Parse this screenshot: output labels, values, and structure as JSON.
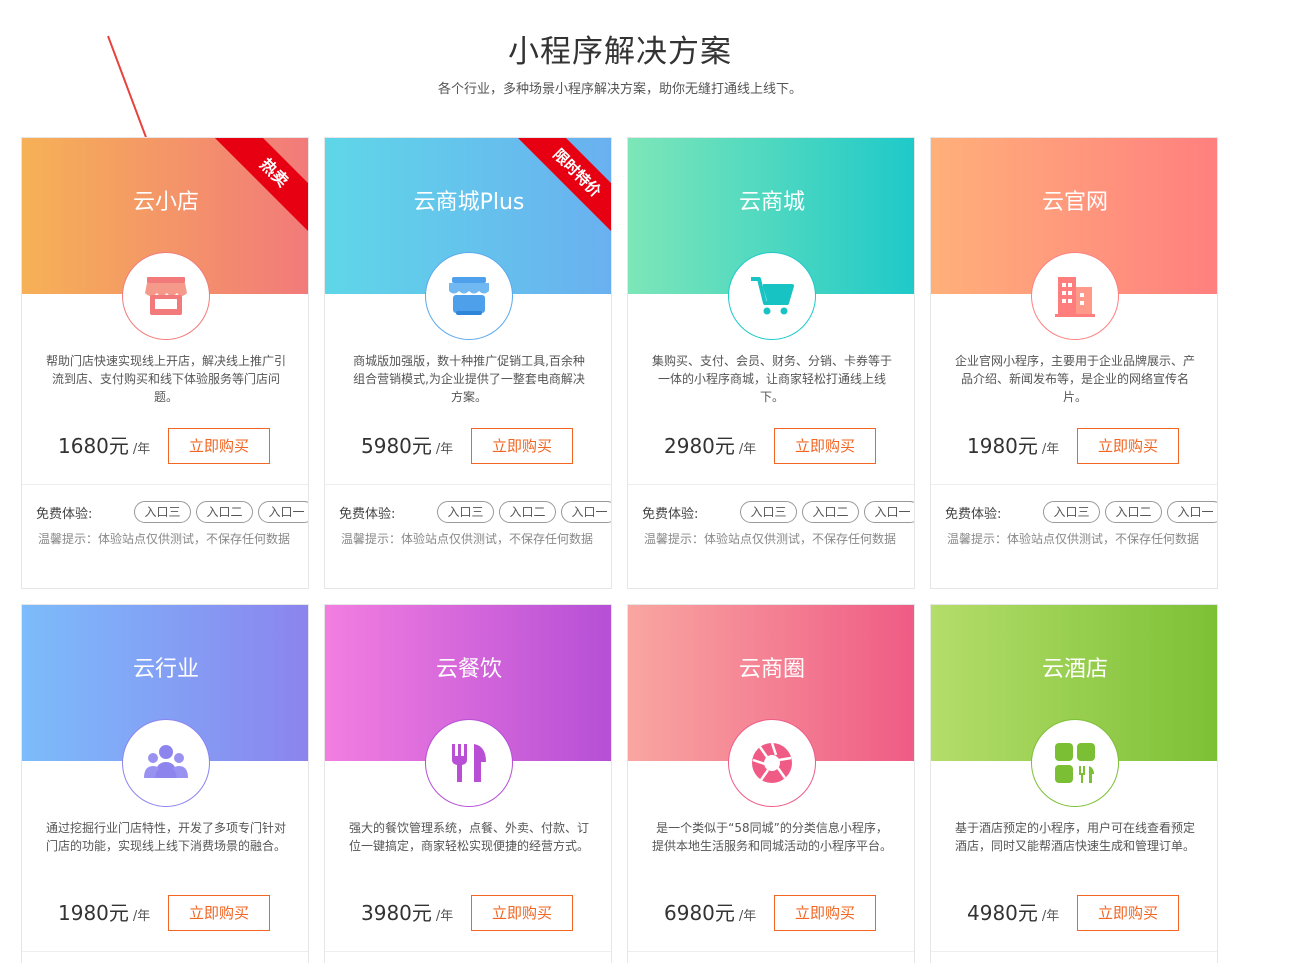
{
  "header": {
    "title": "小程序解决方案",
    "subtitle": "各个行业，多种场景小程序解决方案，助你无缝打通线上线下。"
  },
  "labels": {
    "trial": "免费体验:",
    "note": "温馨提示：体验站点仅供测试，不保存任何数据",
    "entry3": "入口三",
    "entry2": "入口二",
    "entry1": "入口一",
    "buy": "立即购买",
    "unit": "/年"
  },
  "cards": [
    {
      "title": "云小店",
      "ribbon": "热卖",
      "price": "1680元",
      "desc": "帮助门店快速实现线上开店，解决线上推广引流到店、支付购买和线下体验服务等门店问题。",
      "colors": [
        "#f6b156",
        "#f27a7a"
      ],
      "icon": "store-icon"
    },
    {
      "title": "云商城Plus",
      "ribbon": "限时特价",
      "price": "5980元",
      "desc": "商城版加强版，数十种推广促销工具,百余种组合营销模式,为企业提供了一整套电商解决方案。",
      "colors": [
        "#5fd6e8",
        "#6ab0f0"
      ],
      "icon": "shop-icon"
    },
    {
      "title": "云商城",
      "ribbon": "",
      "price": "2980元",
      "desc": "集购买、支付、会员、财务、分销、卡券等于一体的小程序商城，让商家轻松打通线上线下。",
      "colors": [
        "#7de6b8",
        "#1ec9c9"
      ],
      "icon": "cart-icon"
    },
    {
      "title": "云官网",
      "ribbon": "",
      "price": "1980元",
      "desc": "企业官网小程序，主要用于企业品牌展示、产品介绍、新闻发布等，是企业的网络宣传名片。",
      "colors": [
        "#ffb07a",
        "#ff7f7f"
      ],
      "icon": "building-icon"
    },
    {
      "title": "云行业",
      "ribbon": "",
      "price": "1980元",
      "desc": "通过挖掘行业门店特性，开发了多项专门针对门店的功能，实现线上线下消费场景的融合。",
      "colors": [
        "#7cbcfb",
        "#8b84ee"
      ],
      "icon": "people-icon"
    },
    {
      "title": "云餐饮",
      "ribbon": "",
      "price": "3980元",
      "desc": "强大的餐饮管理系统，点餐、外卖、付款、订位一键搞定，商家轻松实现便捷的经营方式。",
      "colors": [
        "#f27ee0",
        "#b64fd6"
      ],
      "icon": "fork-knife-icon"
    },
    {
      "title": "云商圈",
      "ribbon": "",
      "price": "6980元",
      "desc": "是一个类似于“58同城”的分类信息小程序，提供本地生活服务和同城活动的小程序平台。",
      "colors": [
        "#f9a6a1",
        "#ef5b85"
      ],
      "icon": "aperture-icon"
    },
    {
      "title": "云酒店",
      "ribbon": "",
      "price": "4980元",
      "desc": "基于酒店预定的小程序，用户可在线查看预定酒店，同时又能帮酒店快速生成和管理订单。",
      "colors": [
        "#b4dd6a",
        "#7cc035"
      ],
      "icon": "hotel-icon"
    }
  ]
}
